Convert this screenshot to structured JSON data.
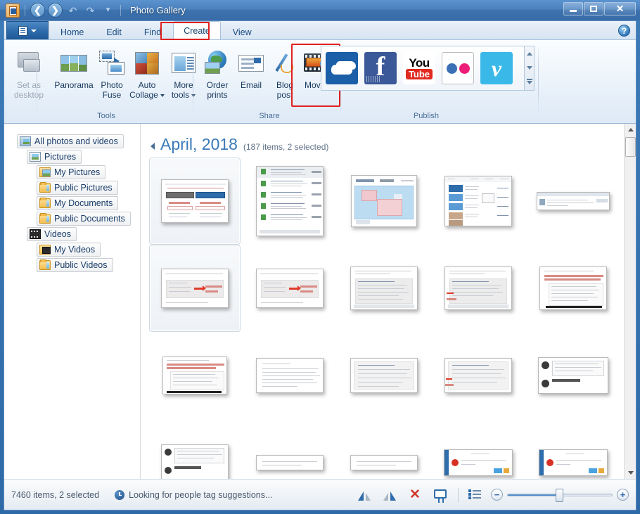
{
  "window": {
    "title": "Photo Gallery",
    "app_icon": "photo-gallery-icon",
    "controls": {
      "minimize": "–",
      "maximize": "□",
      "close": "✕"
    },
    "quick_access": [
      "back-arrow",
      "forward-arrow",
      "undo-arrow",
      "redo-arrow",
      "customize-arrow"
    ]
  },
  "ribbon": {
    "file_menu_label": "File menu",
    "tabs": [
      {
        "label": "Home",
        "active": false
      },
      {
        "label": "Edit",
        "active": false
      },
      {
        "label": "Find",
        "active": false
      },
      {
        "label": "Create",
        "active": true
      },
      {
        "label": "View",
        "active": false
      }
    ],
    "highlight_color": "#e02020",
    "help_label": "?",
    "groups": [
      {
        "name": "tools",
        "label": "Tools",
        "buttons": [
          {
            "label": "Set as\ndesktop",
            "line1": "Set as",
            "line2": "desktop",
            "icon": "monitor-icon",
            "disabled": true,
            "dropdown": false
          },
          {
            "label": "Panorama",
            "line1": "Panorama",
            "line2": "",
            "icon": "panorama-icon",
            "disabled": false,
            "dropdown": false
          },
          {
            "label": "Photo Fuse",
            "line1": "Photo",
            "line2": "Fuse",
            "icon": "photo-fuse-icon",
            "disabled": false,
            "dropdown": false
          },
          {
            "label": "Auto Collage",
            "line1": "Auto",
            "line2": "Collage",
            "icon": "auto-collage-icon",
            "disabled": false,
            "dropdown": true
          },
          {
            "label": "More tools",
            "line1": "More",
            "line2": "tools",
            "icon": "more-tools-icon",
            "disabled": false,
            "dropdown": true
          }
        ]
      },
      {
        "name": "share",
        "label": "Share",
        "buttons": [
          {
            "label": "Order prints",
            "line1": "Order",
            "line2": "prints",
            "icon": "order-prints-icon",
            "disabled": false,
            "dropdown": false
          },
          {
            "label": "Email",
            "line1": "Email",
            "line2": "",
            "icon": "email-icon",
            "disabled": false,
            "dropdown": false
          },
          {
            "label": "Blog post",
            "line1": "Blog",
            "line2": "post",
            "icon": "blog-post-icon",
            "disabled": false,
            "dropdown": false
          },
          {
            "label": "Movie",
            "line1": "Movie",
            "line2": "",
            "icon": "movie-icon",
            "disabled": false,
            "dropdown": false,
            "highlighted": true
          }
        ]
      },
      {
        "name": "publish",
        "label": "Publish",
        "services": [
          {
            "name": "OneDrive",
            "icon": "onedrive-icon",
            "color": "#1a5fa8"
          },
          {
            "name": "Facebook",
            "icon": "facebook-icon",
            "color": "#3b5998"
          },
          {
            "name": "YouTube",
            "icon": "youtube-icon",
            "color": "#e02a20",
            "text_top": "You",
            "text_bottom": "Tube"
          },
          {
            "name": "Flickr",
            "icon": "flickr-icon",
            "color": "#ffffff",
            "dot1": "#3b6fb6",
            "dot2": "#ed1e79"
          },
          {
            "name": "Vimeo",
            "icon": "vimeo-icon",
            "color": "#3ab9e8",
            "glyph": "v"
          }
        ]
      }
    ]
  },
  "sidebar": {
    "items": [
      {
        "label": "All photos and videos",
        "icon": "gallery-icon",
        "indent": 0
      },
      {
        "label": "Pictures",
        "icon": "pictures-icon",
        "indent": 1
      },
      {
        "label": "My Pictures",
        "icon": "folder-pictures-icon",
        "indent": 2
      },
      {
        "label": "Public Pictures",
        "icon": "folder-icon",
        "indent": 2
      },
      {
        "label": "My Documents",
        "icon": "folder-icon",
        "indent": 2
      },
      {
        "label": "Public Documents",
        "icon": "folder-icon",
        "indent": 2
      },
      {
        "label": "Videos",
        "icon": "videos-icon",
        "indent": 1
      },
      {
        "label": "My Videos",
        "icon": "folder-videos-icon",
        "indent": 2
      },
      {
        "label": "Public Videos",
        "icon": "folder-icon",
        "indent": 2
      }
    ]
  },
  "gallery": {
    "group_date": "April, 2018",
    "group_count": "(187 items, 2 selected)",
    "collapse_icon": "collapse-triangle-icon",
    "thumbnails": [
      {
        "id": 1,
        "kind": "pricing-table",
        "selected": true
      },
      {
        "id": 2,
        "kind": "search-results",
        "selected": false
      },
      {
        "id": 3,
        "kind": "map",
        "selected": false
      },
      {
        "id": 4,
        "kind": "article-list",
        "selected": false
      },
      {
        "id": 5,
        "kind": "wide-banner",
        "selected": false
      },
      {
        "id": 6,
        "kind": "steps-annotated",
        "selected": true
      },
      {
        "id": 7,
        "kind": "steps-annotated",
        "selected": false
      },
      {
        "id": 8,
        "kind": "steps-list",
        "selected": false
      },
      {
        "id": 9,
        "kind": "steps-list",
        "selected": false
      },
      {
        "id": 10,
        "kind": "text-red-note",
        "selected": false
      },
      {
        "id": 11,
        "kind": "text-red-note",
        "selected": false
      },
      {
        "id": 12,
        "kind": "paragraph-block",
        "selected": false
      },
      {
        "id": 13,
        "kind": "bullet-block",
        "selected": false
      },
      {
        "id": 14,
        "kind": "bullet-arrow",
        "selected": false
      },
      {
        "id": 15,
        "kind": "avatar-panel",
        "selected": false
      },
      {
        "id": 16,
        "kind": "avatar-panel",
        "selected": false
      },
      {
        "id": 17,
        "kind": "thin-lines",
        "selected": false
      },
      {
        "id": 18,
        "kind": "thin-lines",
        "selected": false
      },
      {
        "id": 19,
        "kind": "dialog-box",
        "selected": false
      },
      {
        "id": 20,
        "kind": "dialog-box",
        "selected": false
      }
    ],
    "scrollbar": {
      "up_icon": "scroll-up-icon",
      "down_icon": "scroll-down-icon"
    }
  },
  "statusbar": {
    "item_count": "7460 items, 2 selected",
    "activity_icon": "clock-icon",
    "activity_text": "Looking for people tag suggestions...",
    "tools": [
      {
        "name": "rotate-left",
        "icon": "rotate-left-icon"
      },
      {
        "name": "rotate-right",
        "icon": "rotate-right-icon"
      },
      {
        "name": "delete",
        "icon": "delete-icon",
        "glyph": "✕"
      },
      {
        "name": "slideshow",
        "icon": "slideshow-icon"
      },
      {
        "name": "details-view",
        "icon": "details-view-icon"
      }
    ],
    "zoom": {
      "out_glyph": "−",
      "in_glyph": "+",
      "value": 46
    }
  }
}
